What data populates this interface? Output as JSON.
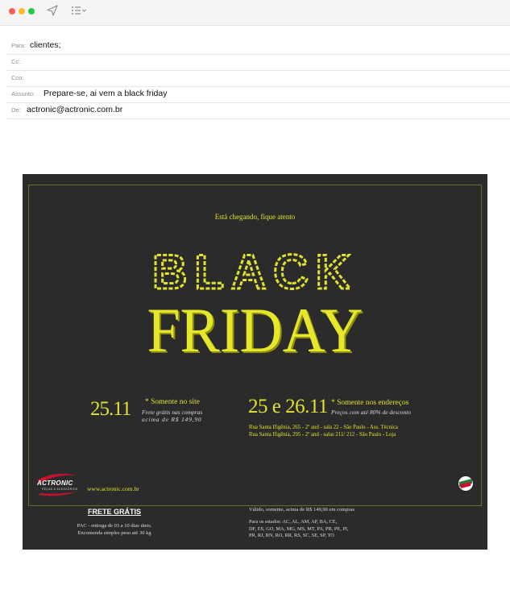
{
  "window": {
    "toolbar": {
      "send_icon": "send-icon",
      "format_icon": "list-format-icon"
    }
  },
  "headers": {
    "to": {
      "label": "Para:",
      "value": "clientes;"
    },
    "cc": {
      "label": "Cc:",
      "value": ""
    },
    "bcc": {
      "label": "Cco:",
      "value": ""
    },
    "subject": {
      "label": "Assunto:",
      "value": "Prepare-se, ai vem a black friday"
    },
    "from": {
      "label": "De:",
      "value": "actronic@actronic.com.br"
    }
  },
  "email": {
    "colors": {
      "background": "#2b2b2b",
      "accent": "#e1e22c"
    },
    "tagline": "Está chegando, fique atento",
    "headline_top": "BLACK",
    "headline_bottom": "FRIDAY",
    "site_promo": {
      "date": "25.11",
      "heading": "* Somente no site",
      "line1": "Frete grátis nas compras",
      "line2": "acima de R$ 149,90"
    },
    "store_promo": {
      "date": "25 e 26.11",
      "heading": "* Somente nos endereços",
      "sub": "Preços com até 80% de desconto",
      "address1": "Rua Santa Ifigênia, 265 - 2º and - sala 22 - São Paulo - Ass. Técnica",
      "address2": "Rua Santa Ifigênia, 295 - 2º and - salas 211/ 212 - São Paulo - Loja"
    },
    "logo": {
      "name": "ACTRONIC",
      "tagline": "PEÇAS & ACESSÓRIOS"
    },
    "website": "www.actronic.com.br",
    "frete": {
      "title": "FRETE GRÁTIS",
      "line1": "PAC - entrega de 03 a 10 dias úteis.",
      "line2": "Encomenda simples peso até 30 kg"
    },
    "validity": "Válido, somente, acima de R$ 149,90 em compras",
    "states": {
      "line1": "Para os estados: AC, AL, AM, AP, BA, CE,",
      "line2": "DF, ES, GO, MA, MG, MS, MT, PA, PB, PE, PI,",
      "line3": "PR, RJ, RN, RO, RR, RS, SC, SE, SP, TO"
    }
  }
}
